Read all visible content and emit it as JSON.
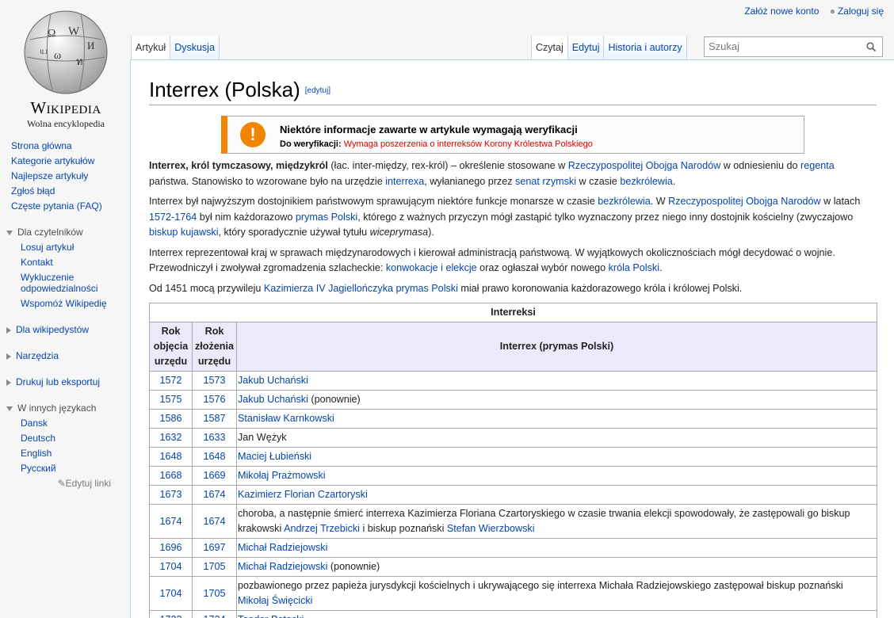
{
  "header": {
    "create_account": "Załóż nowe konto",
    "login": "Zaloguj się"
  },
  "logo": {
    "wordmark": "Wikipedia",
    "tagline": "Wolna encyklopedia"
  },
  "sidebar": {
    "nav": [
      "Strona główna",
      "Kategorie artykułów",
      "Najlepsze artykuły",
      "Zgłoś błąd",
      "Częste pytania (FAQ)"
    ],
    "readers_heading": "Dla czytelników",
    "readers": [
      "Losuj artykuł",
      "Kontakt",
      "Wykluczenie odpowiedzialności",
      "Wspomóż Wikipedię"
    ],
    "wikipedians_heading": "Dla wikipedystów",
    "tools_heading": "Narzędzia",
    "print_heading": "Drukuj lub eksportuj",
    "languages_heading": "W innych językach",
    "languages": [
      "Dansk",
      "Deutsch",
      "English",
      "Русский"
    ],
    "edit_links": "Edytuj linki"
  },
  "tabs": {
    "article": "Artykuł",
    "discussion": "Dyskusja",
    "read": "Czytaj",
    "edit": "Edytuj",
    "history": "Historia i autorzy"
  },
  "search": {
    "placeholder": "Szukaj"
  },
  "page": {
    "title": "Interrex (Polska)",
    "edit_link": "[edytuj]"
  },
  "notice": {
    "text": "Niektóre informacje zawarte w artykule wymagają weryfikacji",
    "prefix": "Do weryfikacji:",
    "detail": "Wymaga poszerzenia o interreksów Korony Królestwa Polskiego"
  },
  "table": {
    "caption": "Interreksi",
    "headers": [
      "Rok objęcia urzędu",
      "Rok złożenia urzędu",
      "Interrex (prymas Polski)"
    ]
  }
}
